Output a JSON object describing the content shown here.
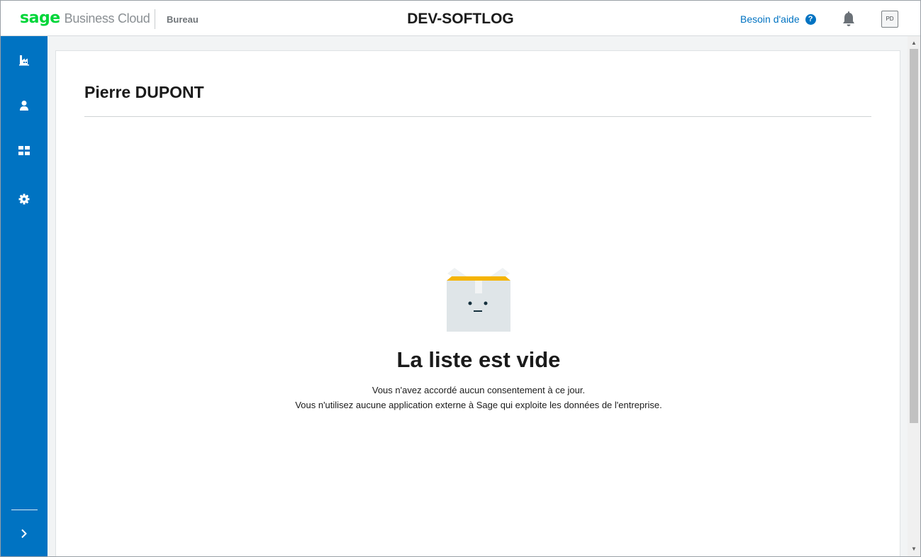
{
  "header": {
    "brand": "sage",
    "product": "Business Cloud",
    "section": "Bureau",
    "company": "DEV-SOFTLOG",
    "help_label": "Besoin d'aide",
    "help_icon": "?",
    "avatar_initials": "PD"
  },
  "sidebar": {
    "items": [
      {
        "icon": "factory-icon"
      },
      {
        "icon": "user-icon"
      },
      {
        "icon": "grid-icon"
      },
      {
        "icon": "gear-icon"
      }
    ],
    "expand_icon": "chevron-right-icon"
  },
  "main": {
    "user_name": "Pierre DUPONT",
    "empty_state": {
      "title": "La liste est vide",
      "line1": "Vous n'avez accordé aucun consentement à ce jour.",
      "line2": "Vous n'utilisez aucune application externe à Sage qui exploite les données de l'entreprise."
    }
  },
  "colors": {
    "accent": "#0073c2",
    "brand_green": "#00d639",
    "box_lid": "#f5b400"
  }
}
